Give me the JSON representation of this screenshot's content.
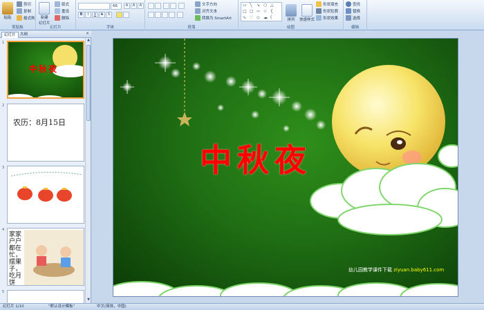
{
  "ribbon": {
    "groups": {
      "clipboard": "剪贴板",
      "slides": "幻灯片",
      "font": "字体",
      "paragraph": "段落",
      "drawing": "绘图",
      "editing": "编辑"
    },
    "clipboard": {
      "paste": "粘贴",
      "cut": "剪切",
      "copy": "复制",
      "format_painter": "格式刷"
    },
    "slides": {
      "new_slide_1": "新建",
      "new_slide_2": "幻灯片",
      "layout": "版式",
      "reset": "重设",
      "delete": "删除"
    },
    "font": {
      "font_size": "66",
      "grow": "A",
      "shrink": "A",
      "clear": "A",
      "bold": "B",
      "italic": "I",
      "underline": "U",
      "strike": "S",
      "shadow": "S"
    },
    "paragraph": {
      "text_direction": "文字方向",
      "align_text": "对齐文本",
      "smartart": "转换为 SmartArt"
    },
    "drawing": {
      "arrange": "排列",
      "quick_styles": "快速样式",
      "shape_fill": "形状填充",
      "shape_outline": "形状轮廓",
      "shape_effects": "形状效果"
    },
    "editing": {
      "find": "查找",
      "replace": "替换",
      "select": "选择"
    }
  },
  "left_pane": {
    "tabs": [
      "幻灯片",
      "大纲"
    ],
    "close": "×",
    "slides": [
      {
        "num": "1",
        "title": "中秋夜"
      },
      {
        "num": "2",
        "text": "农历：8月15日"
      },
      {
        "num": "3"
      },
      {
        "num": "4",
        "text": "家家户户都在忙，摆果子，吃月饼"
      },
      {
        "num": "5"
      }
    ]
  },
  "slide": {
    "title": "中秋夜",
    "footer_prefix": "幼儿园教学课件下载",
    "footer_link": "ziyuan.baby611.com"
  },
  "status": {
    "slide_count": "幻灯片 1/10",
    "theme": "\"默认设计模板\"",
    "language": "中文(简体，中国)"
  },
  "colors": {
    "ribbon_bg": "#dae6f4",
    "slide_green": "#1f6e14",
    "title_red": "#ff0000",
    "moon_yellow": "#f8e36a",
    "selection_orange": "#f2a23b"
  }
}
